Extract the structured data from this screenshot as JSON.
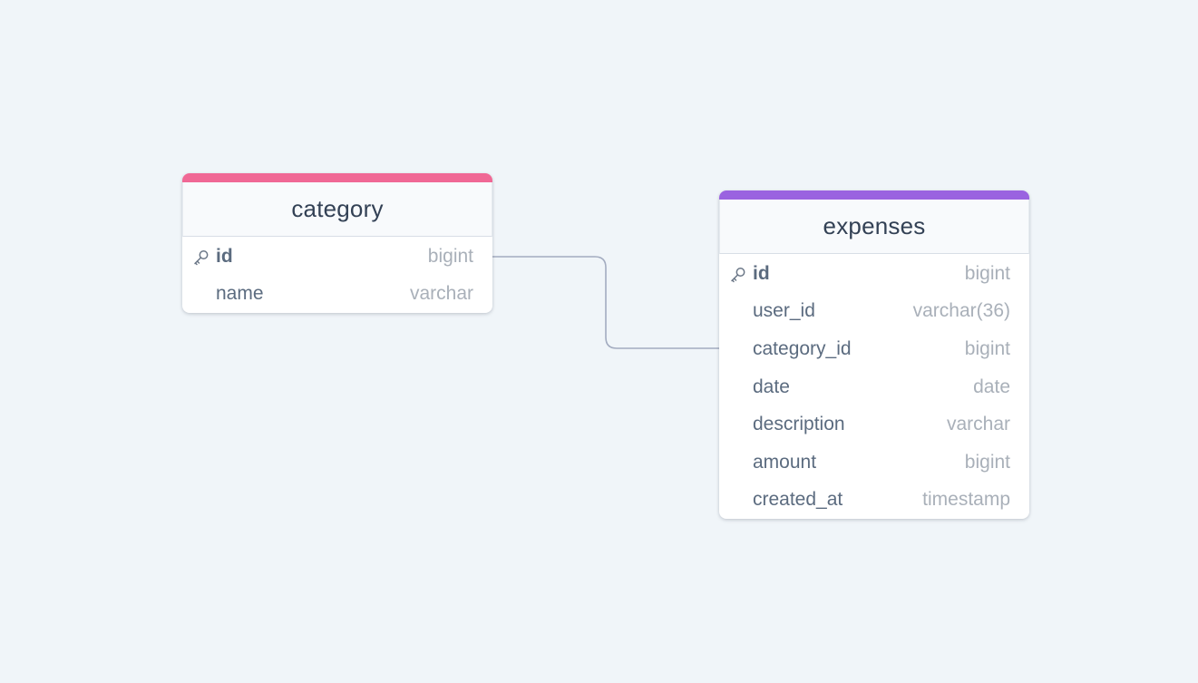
{
  "tables": [
    {
      "name": "category",
      "accent_color": "#f06895",
      "columns": [
        {
          "name": "id",
          "type": "bigint",
          "primary_key": true
        },
        {
          "name": "name",
          "type": "varchar",
          "primary_key": false
        }
      ]
    },
    {
      "name": "expenses",
      "accent_color": "#9a63e0",
      "columns": [
        {
          "name": "id",
          "type": "bigint",
          "primary_key": true
        },
        {
          "name": "user_id",
          "type": "varchar(36)",
          "primary_key": false
        },
        {
          "name": "category_id",
          "type": "bigint",
          "primary_key": false
        },
        {
          "name": "date",
          "type": "date",
          "primary_key": false
        },
        {
          "name": "description",
          "type": "varchar",
          "primary_key": false
        },
        {
          "name": "amount",
          "type": "bigint",
          "primary_key": false
        },
        {
          "name": "created_at",
          "type": "timestamp",
          "primary_key": false
        }
      ]
    }
  ],
  "relations": [
    {
      "from_table": "category",
      "from_column": "id",
      "to_table": "expenses",
      "to_column": "category_id"
    }
  ],
  "colors": {
    "background": "#f0f5f9",
    "relation_line": "#a3acc0",
    "key_icon": "#6b7787"
  },
  "icons": {
    "primary_key": "key-icon"
  }
}
